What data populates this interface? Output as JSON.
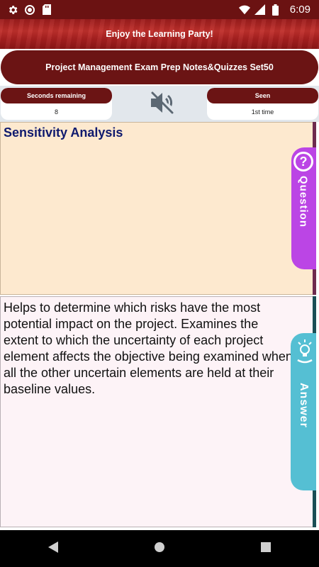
{
  "status_bar": {
    "time": "6:09",
    "icons_left": [
      "settings-icon",
      "circle-icon",
      "sd-card-icon"
    ],
    "icons_right": [
      "wifi-icon",
      "signal-icon",
      "battery-icon"
    ]
  },
  "banner": {
    "text": "Enjoy the Learning Party!"
  },
  "title": {
    "text": "Project Management Exam Prep Notes&Quizzes Set50"
  },
  "info": {
    "seconds_label": "Seconds remaining",
    "seconds_value": "8",
    "seen_label": "Seen",
    "seen_value": "1st time",
    "mute_icon": "volume-muted-icon"
  },
  "question": {
    "text": "Sensitivity Analysis",
    "tab_label": "Question",
    "tab_symbol": "?"
  },
  "answer": {
    "text": "Helps to determine which risks have the most potential impact on the project. Examines the extent to which the uncertainty of each project element affects the objective being examined when all the other uncertain elements are held at their baseline values.",
    "tab_label": "Answer",
    "tab_icon": "lightbulb-icon"
  },
  "colors": {
    "brand": "#6b1414",
    "question_bg": "#fde9cf",
    "question_tab": "#bb45e5",
    "question_text": "#0f1a6e",
    "answer_bg": "#fdf3f7",
    "answer_tab": "#55bfd3"
  },
  "nav_bar": {
    "icons": [
      "back-icon",
      "home-icon",
      "recents-icon"
    ]
  }
}
